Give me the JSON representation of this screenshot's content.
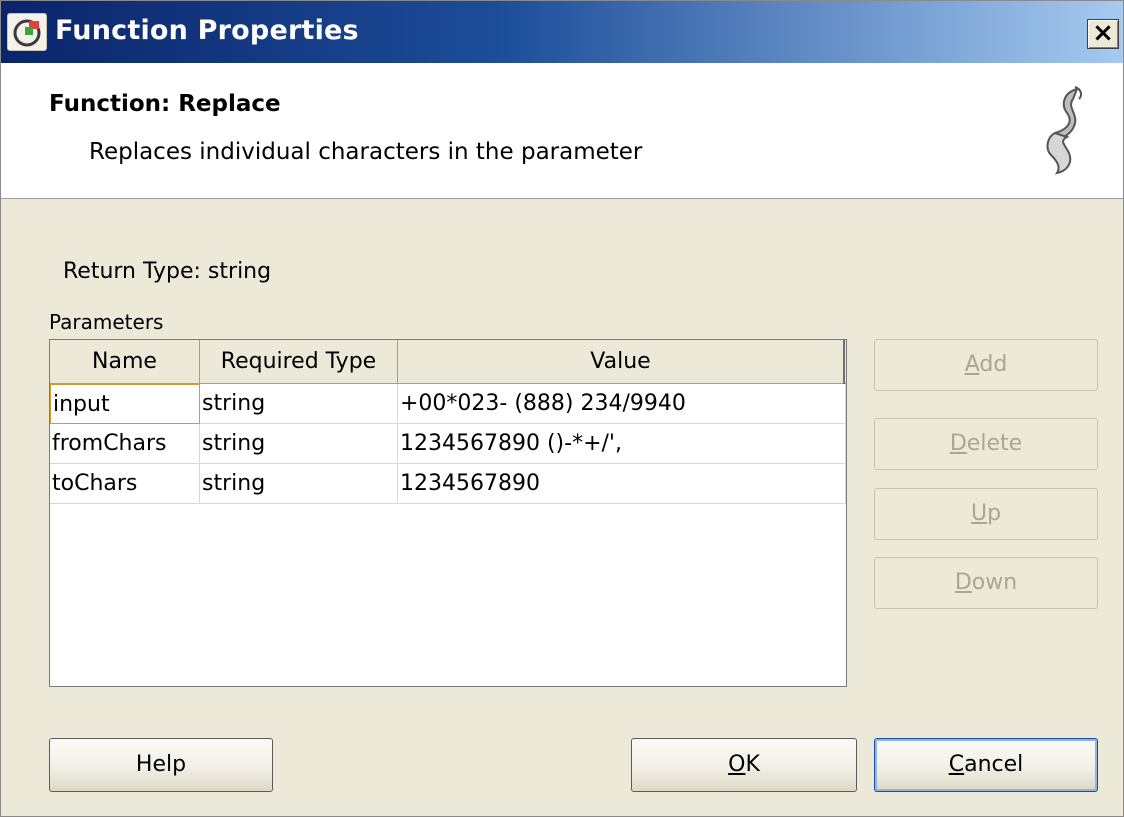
{
  "window": {
    "title": "Function Properties",
    "close_label": "×"
  },
  "header": {
    "function_title": "Function: Replace",
    "description": "Replaces individual characters in the parameter"
  },
  "return_type_text": "Return Type: string",
  "parameters_label": "Parameters",
  "table": {
    "columns": [
      "Name",
      "Required Type",
      "Value"
    ],
    "rows": [
      {
        "name": "input",
        "type": "string",
        "value": "+00*023- (888) 234/9940"
      },
      {
        "name": "fromChars",
        "type": "string",
        "value": "1234567890 ()-*+/',"
      },
      {
        "name": "toChars",
        "type": "string",
        "value": "1234567890"
      }
    ]
  },
  "side_buttons": {
    "add": {
      "mnemonic": "A",
      "rest": "dd"
    },
    "delete": {
      "mnemonic": "D",
      "rest": "elete"
    },
    "up": {
      "mnemonic": "U",
      "rest": "p"
    },
    "down": {
      "mnemonic": "D",
      "rest": "own"
    }
  },
  "buttons": {
    "help": "Help",
    "ok": {
      "mnemonic": "O",
      "rest": "K"
    },
    "cancel": {
      "mnemonic": "C",
      "rest": "ancel"
    }
  },
  "colors": {
    "title_bar_start": "#0a246a",
    "title_bar_end": "#a6caf0",
    "dialog_bg": "#ece9d8",
    "disabled_text": "#a9a693",
    "focus_border": "#d79a2e"
  },
  "icons": {
    "app": "function-properties-app-icon",
    "header": "scroll-icon"
  }
}
